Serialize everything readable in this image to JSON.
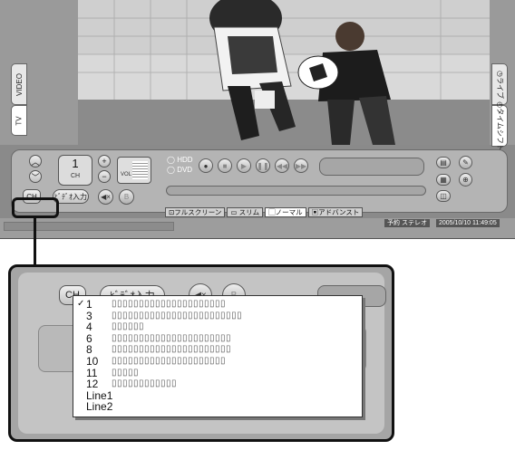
{
  "tabs_left": [
    "VIDEO",
    "TV"
  ],
  "tabs_right": [
    "ライブ",
    "タイムシフト"
  ],
  "tuner": {
    "number": "1",
    "unit": "CH",
    "vol_label": "VOL"
  },
  "source": {
    "option1": "HDD",
    "option2": "DVD"
  },
  "buttons": {
    "ch": "CH",
    "input": "ﾋﾞﾃﾞｵ入力",
    "mute": "◀×",
    "sub": "B"
  },
  "modes": [
    "フルスクリーン",
    "スリム",
    "ノーマル",
    "アドバンスト"
  ],
  "selected_mode": "ノーマル",
  "status": {
    "audio": "予約  ステレオ",
    "datetime": "2005/10/10 11:49:05"
  },
  "zoom": {
    "ch_button": "CH",
    "input_button": "ﾋﾞﾃﾞｵ入力"
  },
  "channel_list": [
    {
      "num": "1",
      "checked": true,
      "program": "▯▯▯▯▯▯▯▯▯▯▯▯▯▯▯▯▯▯▯▯▯"
    },
    {
      "num": "3",
      "checked": false,
      "program": "▯▯▯▯▯▯▯▯▯▯▯▯▯▯▯▯▯▯▯▯▯▯▯▯"
    },
    {
      "num": "4",
      "checked": false,
      "program": "▯▯▯▯▯▯"
    },
    {
      "num": "6",
      "checked": false,
      "program": "▯▯▯▯▯▯▯▯▯▯▯▯▯▯▯▯▯▯▯▯▯▯"
    },
    {
      "num": "8",
      "checked": false,
      "program": "▯▯▯▯▯▯▯▯▯▯▯▯▯▯▯▯▯▯▯▯▯▯"
    },
    {
      "num": "10",
      "checked": false,
      "program": "▯▯▯▯▯▯▯▯▯▯▯▯▯▯▯▯▯▯▯▯▯"
    },
    {
      "num": "11",
      "checked": false,
      "program": "▯▯▯▯▯"
    },
    {
      "num": "12",
      "checked": false,
      "program": "▯▯▯▯▯▯▯▯▯▯▯▯"
    },
    {
      "num": "Line1",
      "checked": false,
      "program": ""
    },
    {
      "num": "Line2",
      "checked": false,
      "program": ""
    }
  ]
}
